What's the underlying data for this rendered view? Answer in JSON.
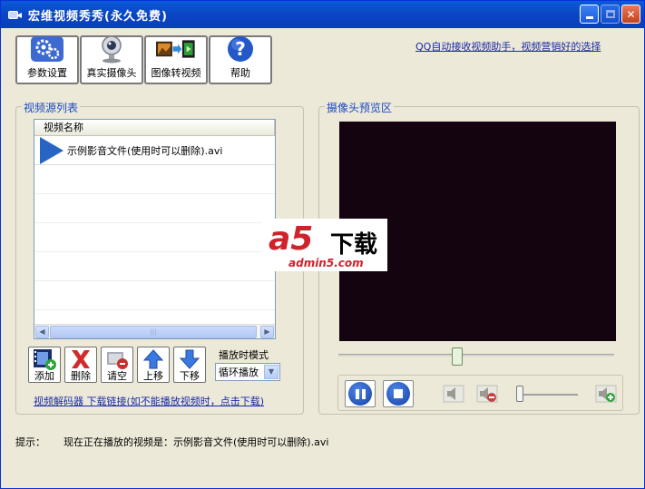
{
  "window": {
    "title": "宏维视频秀秀(永久免费)"
  },
  "toolbar": {
    "items": [
      {
        "label": "参数设置",
        "icon": "gears-icon"
      },
      {
        "label": "真实摄像头",
        "icon": "webcam-icon"
      },
      {
        "label": "图像转视频",
        "icon": "film-convert-icon"
      },
      {
        "label": "帮助",
        "icon": "help-icon"
      }
    ]
  },
  "top_link": "QQ自动接收视频助手，视频营销好的选择",
  "source_panel": {
    "title": "视频源列表",
    "column_header": "视频名称",
    "rows": [
      "示例影音文件(使用时可以删除).avi"
    ]
  },
  "list_controls": {
    "add": "添加",
    "delete": "删除",
    "clear": "请空",
    "up": "上移",
    "down": "下移",
    "mode_label": "播放时模式",
    "mode_value": "循环播放"
  },
  "codec": {
    "prefix": "视频解码器 ",
    "link": "下载链接",
    "suffix": "(如不能播放视频时，点击下载)"
  },
  "preview_panel": {
    "title": "摄像头预览区"
  },
  "status": {
    "label": "提示：",
    "message": "现在正在播放的视频是：示例影音文件(使用时可以删除).avi"
  },
  "watermark": {
    "brand": "a5",
    "text": "下载",
    "site": "admin5.com"
  },
  "colors": {
    "title_bar": "#0a5bd8",
    "group_title": "#1a48c4",
    "link": "#1a2aa8",
    "preview_bg": "#140410"
  }
}
